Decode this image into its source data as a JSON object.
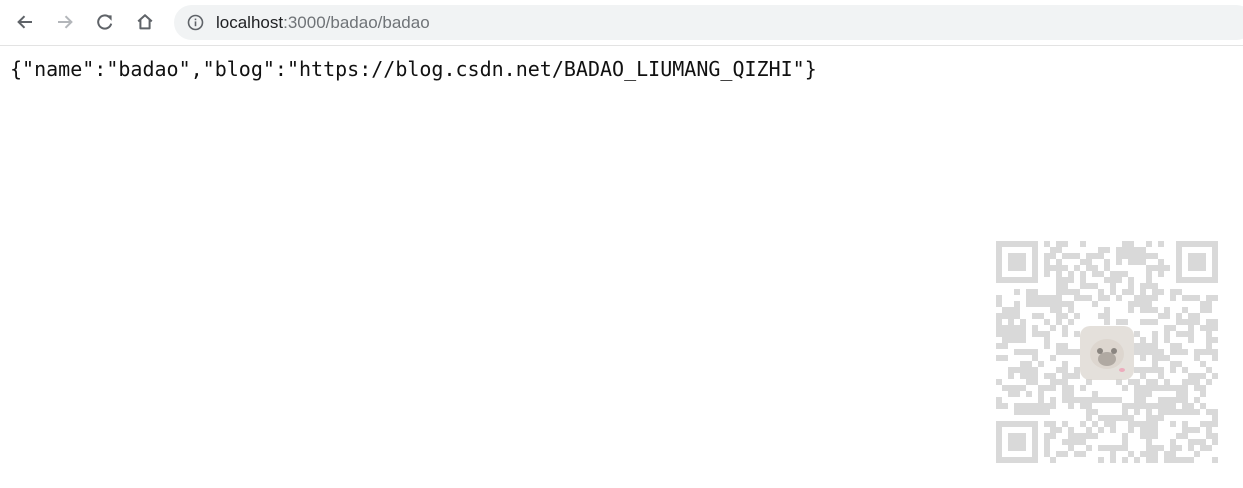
{
  "browser": {
    "toolbar": {
      "back_icon": "arrow-left-icon",
      "forward_icon": "arrow-right-icon",
      "reload_icon": "reload-icon",
      "home_icon": "home-icon"
    },
    "address_bar": {
      "info_icon": "info-circle-icon",
      "host": "localhost",
      "path": ":3000/badao/badao"
    }
  },
  "page": {
    "body_text": "{\"name\":\"badao\",\"blog\":\"https://blog.csdn.net/BADAO_LIUMANG_QIZHI\"}"
  },
  "watermark": {
    "type": "qr-code-with-avatar",
    "color": "#9e9e9e"
  }
}
